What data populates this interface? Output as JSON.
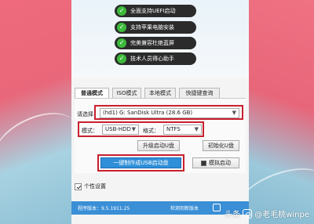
{
  "features": [
    {
      "label": "全面支持UEFI启动"
    },
    {
      "label": "支持苹果电脑安装"
    },
    {
      "label": "完美兼容杜绝蓝屏"
    },
    {
      "label": "技术人员得心助手"
    }
  ],
  "tabs": [
    {
      "label": "普通模式",
      "active": true
    },
    {
      "label": "ISO模式",
      "active": false
    },
    {
      "label": "本地模式",
      "active": false
    },
    {
      "label": "快捷键查询",
      "active": false
    }
  ],
  "form": {
    "select_label": "请选择：",
    "device_value": "(hd1) G: SanDisk Ultra (28.6 GB)",
    "mode_label": "模式：",
    "mode_value": "USB-HDD",
    "format_label": "格式：",
    "format_value": "NTFS"
  },
  "buttons": {
    "upgrade": "升级启动U盘",
    "init": "初始化U盘",
    "make": "一键制作成USB启动盘",
    "simulate": "模拟启动"
  },
  "personal_label": "个性设置",
  "footer": {
    "version": "程序版本：9.5.1911.25",
    "update": "检测到新版本"
  },
  "watermark": {
    "prefix": "头条",
    "author": "@老毛桃winpe"
  },
  "colors": {
    "highlight": "#c8202e",
    "primary": "#2f8fd9",
    "check": "#3dbb3b"
  }
}
